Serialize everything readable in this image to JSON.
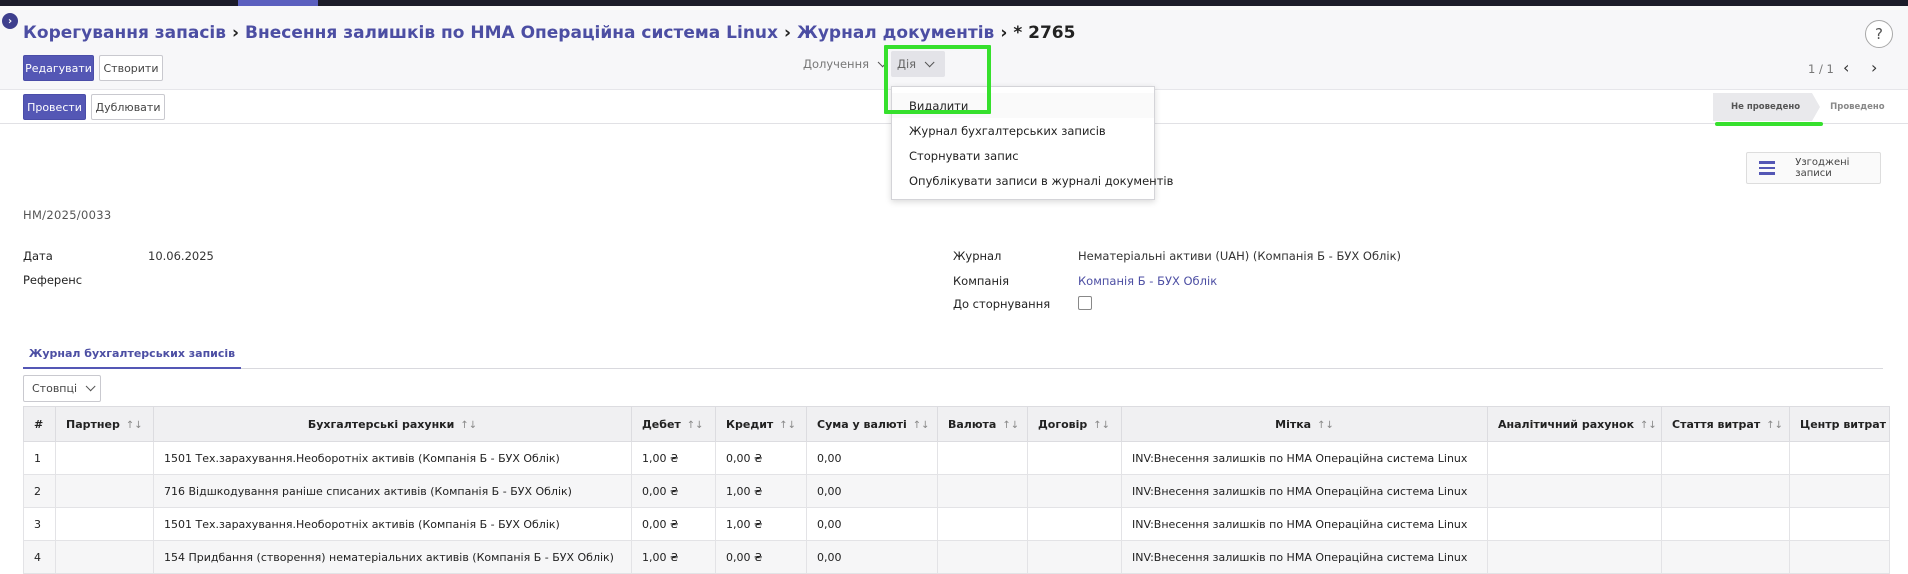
{
  "breadcrumb": {
    "items": [
      "Корегування запасів",
      "Внесення залишків по НМА Операційна система Linux",
      "Журнал документів"
    ],
    "current": "* 2765"
  },
  "help_label": "?",
  "toolbar": {
    "edit_label": "Редагувати",
    "create_label": "Створити",
    "attachments_label": "Долучення",
    "action_label": "Дія",
    "pager_text": "1 / 1"
  },
  "action_menu": {
    "items": [
      "Видалити",
      "Журнал бухгалтерських записів",
      "Сторнувати запис",
      "Опублікувати записи в журналі документів"
    ]
  },
  "header_buttons": {
    "post_label": "Провести",
    "duplicate_label": "Дублювати"
  },
  "status_stages": [
    "Не проведено",
    "Проведено"
  ],
  "smart_button": {
    "icon": "hamburger-icon",
    "label": "Узгоджені записи"
  },
  "form": {
    "name": "НМ/2025/0033",
    "date_label": "Дата",
    "date_value": "10.06.2025",
    "reference_label": "Референс",
    "journal_label": "Журнал",
    "journal_value": "Нематеріальні активи (UAH) (Компанія Б - БУХ Облік)",
    "company_label": "Компанія",
    "company_value": "Компанія Б - БУХ Облік",
    "reversal_label": "До сторнування"
  },
  "tab_label": "Журнал бухгалтерських записів",
  "columns_button_label": "Стовпці",
  "table": {
    "headers": [
      "#",
      "Партнер",
      "Бухгалтерські рахунки",
      "Дебет",
      "Кредит",
      "Сума у валюті",
      "Валюта",
      "Договір",
      "Мітка",
      "Аналітичний рахунок",
      "Стаття витрат",
      "Центр витрат"
    ],
    "rows": [
      [
        "1",
        "",
        "1501 Тех.зарахування.Необоротніх активів (Компанія Б - БУХ Облік)",
        "1,00 ₴",
        "0,00 ₴",
        "0,00",
        "",
        "",
        "INV:Внесення залишків по НМА Операційна система Linux",
        "",
        "",
        ""
      ],
      [
        "2",
        "",
        "716 Відшкодування раніше списаних активів (Компанія Б - БУХ Облік)",
        "0,00 ₴",
        "1,00 ₴",
        "0,00",
        "",
        "",
        "INV:Внесення залишків по НМА Операційна система Linux",
        "",
        "",
        ""
      ],
      [
        "3",
        "",
        "1501 Тех.зарахування.Необоротніх активів (Компанія Б - БУХ Облік)",
        "0,00 ₴",
        "1,00 ₴",
        "0,00",
        "",
        "",
        "INV:Внесення залишків по НМА Операційна система Linux",
        "",
        "",
        ""
      ],
      [
        "4",
        "",
        "154 Придбання (створення) нематеріальних активів (Компанія Б - БУХ Облік)",
        "1,00 ₴",
        "0,00 ₴",
        "0,00",
        "",
        "",
        "INV:Внесення залишків по НМА Операційна система Linux",
        "",
        "",
        ""
      ]
    ]
  }
}
